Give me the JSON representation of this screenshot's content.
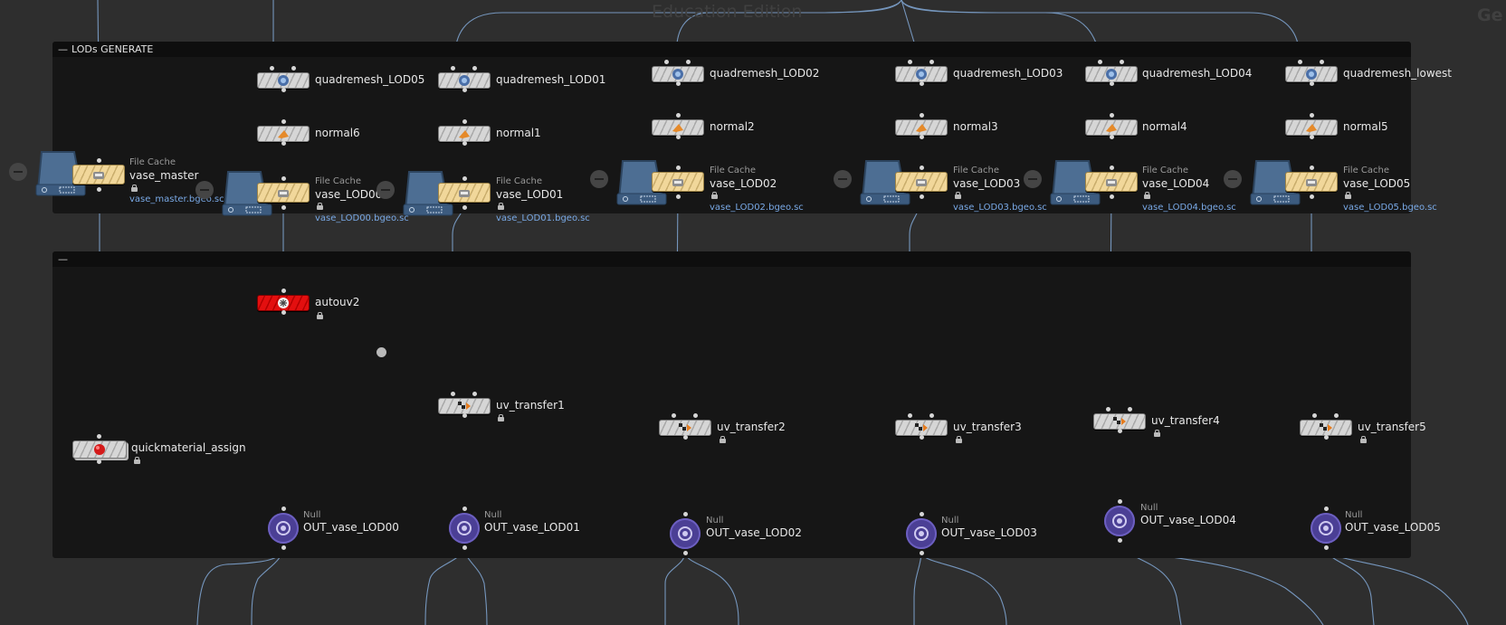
{
  "watermark": {
    "center": "Education Edition",
    "right": "Ge"
  },
  "netboxes": [
    {
      "title": "LODs GENERATE",
      "collapse_symbol": "—"
    },
    {
      "title": "",
      "collapse_symbol": "—"
    }
  ],
  "nodes": {
    "quadremesh_LOD05": {
      "name": "quadremesh_LOD05",
      "icon": "quadremesh-icon"
    },
    "quadremesh_LOD01": {
      "name": "quadremesh_LOD01",
      "icon": "quadremesh-icon"
    },
    "quadremesh_LOD02": {
      "name": "quadremesh_LOD02",
      "icon": "quadremesh-icon"
    },
    "quadremesh_LOD03": {
      "name": "quadremesh_LOD03",
      "icon": "quadremesh-icon"
    },
    "quadremesh_LOD04": {
      "name": "quadremesh_LOD04",
      "icon": "quadremesh-icon"
    },
    "quadremesh_lowest": {
      "name": "quadremesh_lowest",
      "icon": "quadremesh-icon"
    },
    "normal6": {
      "name": "normal6",
      "icon": "normal-icon"
    },
    "normal1": {
      "name": "normal1",
      "icon": "normal-icon"
    },
    "normal2": {
      "name": "normal2",
      "icon": "normal-icon"
    },
    "normal3": {
      "name": "normal3",
      "icon": "normal-icon"
    },
    "normal4": {
      "name": "normal4",
      "icon": "normal-icon"
    },
    "normal5": {
      "name": "normal5",
      "icon": "normal-icon"
    },
    "vase_master": {
      "type": "File Cache",
      "name": "vase_master",
      "path": "vase_master.bgeo.sc",
      "icon": "file-cache-icon"
    },
    "vase_LOD00": {
      "type": "File Cache",
      "name": "vase_LOD00",
      "path": "vase_LOD00.bgeo.sc",
      "icon": "file-cache-icon"
    },
    "vase_LOD01": {
      "type": "File Cache",
      "name": "vase_LOD01",
      "path": "vase_LOD01.bgeo.sc",
      "icon": "file-cache-icon"
    },
    "vase_LOD02": {
      "type": "File Cache",
      "name": "vase_LOD02",
      "path": "vase_LOD02.bgeo.sc",
      "icon": "file-cache-icon"
    },
    "vase_LOD03": {
      "type": "File Cache",
      "name": "vase_LOD03",
      "path": "vase_LOD03.bgeo.sc",
      "icon": "file-cache-icon"
    },
    "vase_LOD04": {
      "type": "File Cache",
      "name": "vase_LOD04",
      "path": "vase_LOD04.bgeo.sc",
      "icon": "file-cache-icon"
    },
    "vase_LOD05": {
      "type": "File Cache",
      "name": "vase_LOD05",
      "path": "vase_LOD05.bgeo.sc",
      "icon": "file-cache-icon"
    },
    "autouv2": {
      "name": "autouv2",
      "icon": "autouv-icon",
      "color": "#e30f0f"
    },
    "uv_transfer1": {
      "name": "uv_transfer1",
      "icon": "uv-transfer-icon"
    },
    "uv_transfer2": {
      "name": "uv_transfer2",
      "icon": "uv-transfer-icon"
    },
    "uv_transfer3": {
      "name": "uv_transfer3",
      "icon": "uv-transfer-icon"
    },
    "uv_transfer4": {
      "name": "uv_transfer4",
      "icon": "uv-transfer-icon"
    },
    "uv_transfer5": {
      "name": "uv_transfer5",
      "icon": "uv-transfer-icon"
    },
    "quickmaterial_assign": {
      "name": "quickmaterial_assign",
      "icon": "material-icon"
    },
    "OUT_vase_LOD00": {
      "type": "Null",
      "name": "OUT_vase_LOD00",
      "icon": "null-icon"
    },
    "OUT_vase_LOD01": {
      "type": "Null",
      "name": "OUT_vase_LOD01",
      "icon": "null-icon"
    },
    "OUT_vase_LOD02": {
      "type": "Null",
      "name": "OUT_vase_LOD02",
      "icon": "null-icon"
    },
    "OUT_vase_LOD03": {
      "type": "Null",
      "name": "OUT_vase_LOD03",
      "icon": "null-icon"
    },
    "OUT_vase_LOD04": {
      "type": "Null",
      "name": "OUT_vase_LOD04",
      "icon": "null-icon"
    },
    "OUT_vase_LOD05": {
      "type": "Null",
      "name": "OUT_vase_LOD05",
      "icon": "null-icon"
    }
  },
  "colors": {
    "background": "#2e2e2e",
    "netbox": "#161616",
    "wire": "#7596bd",
    "file_cache_node": "#f1d79a",
    "generic_node": "#d6d6d6",
    "autouv_node": "#e30f0f",
    "null_node": "#4b3f95",
    "path_text": "#79a9e6"
  }
}
